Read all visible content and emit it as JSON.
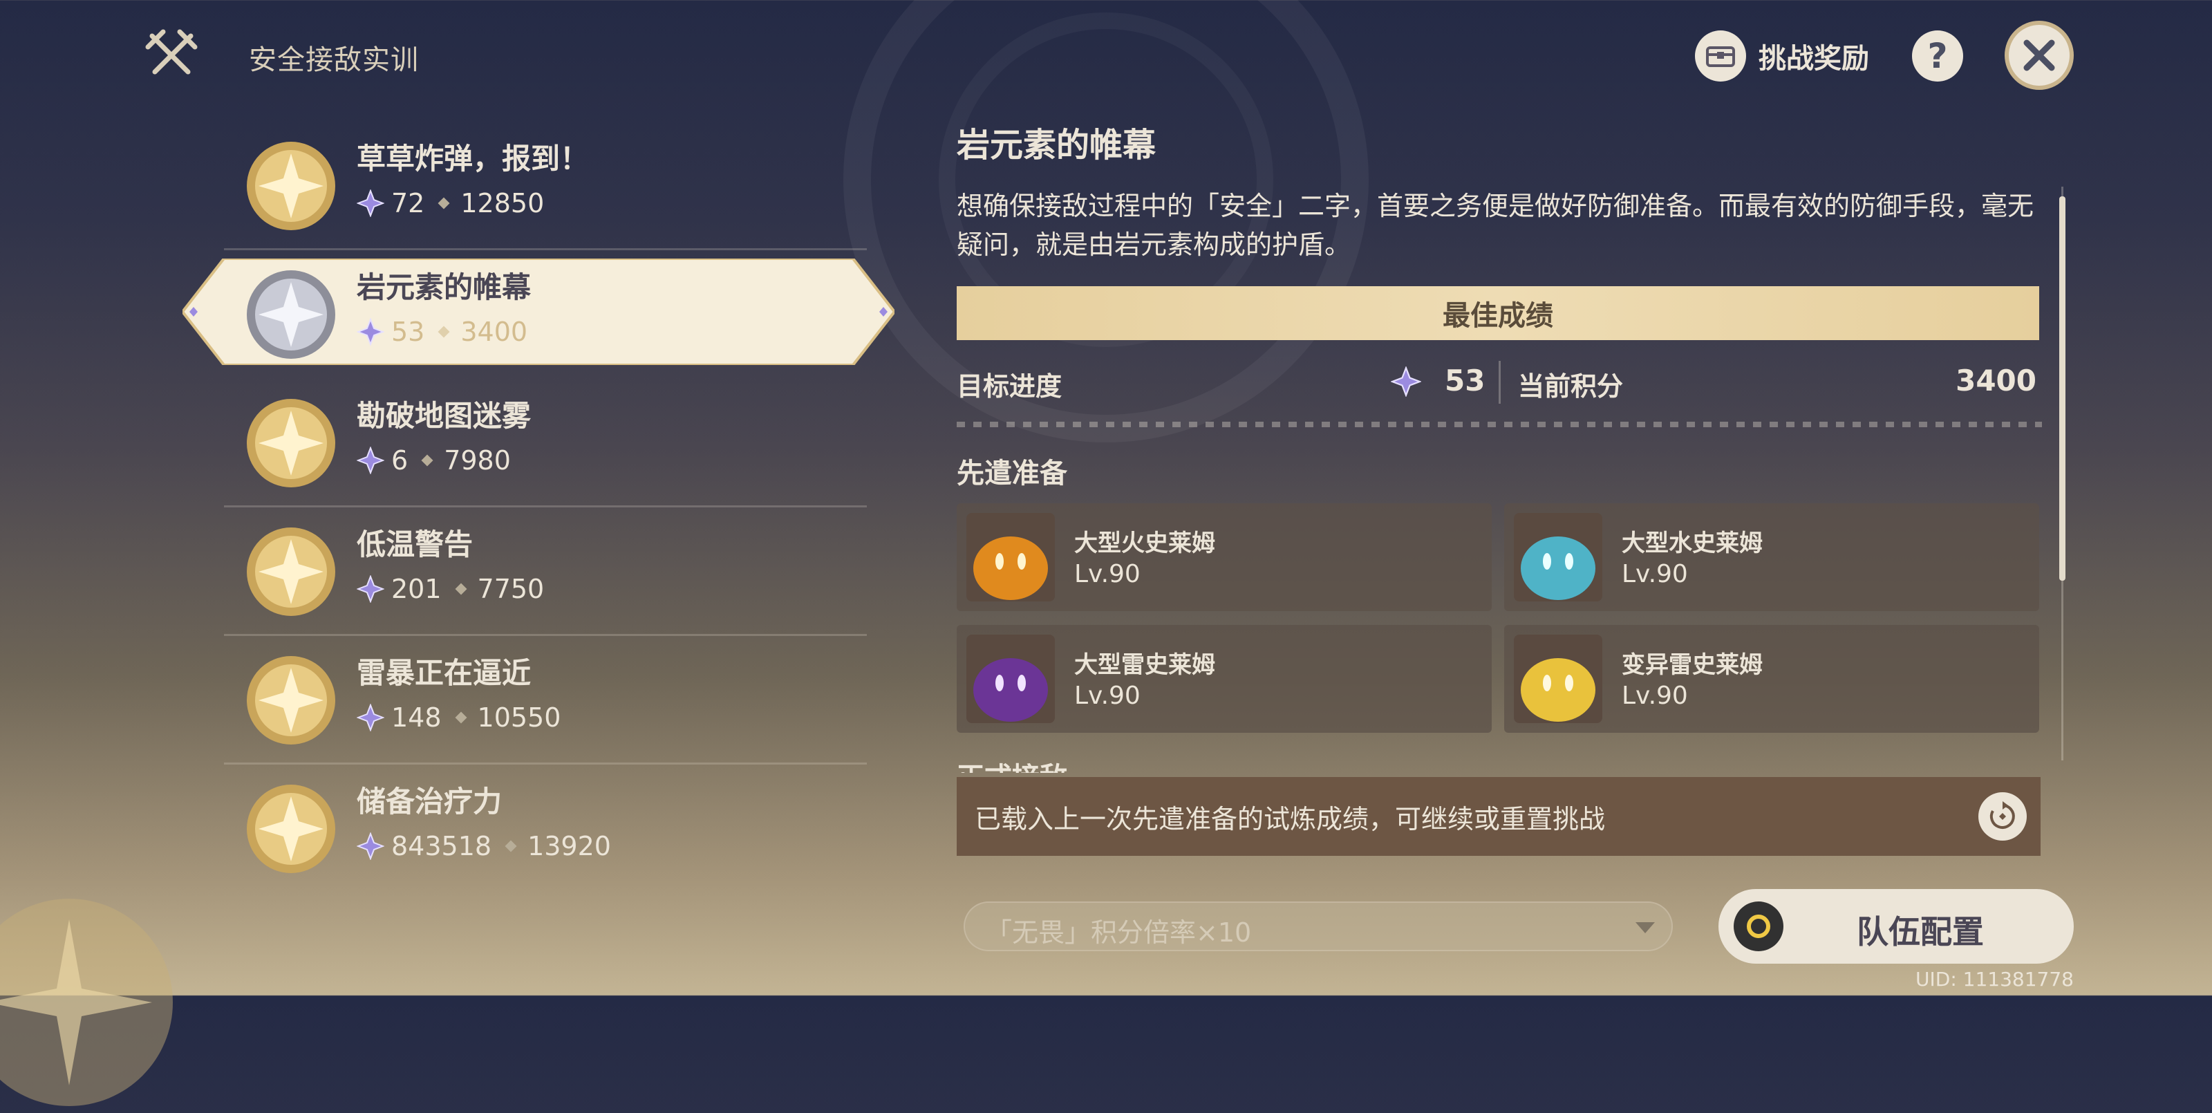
{
  "header": {
    "title": "安全接敌实训",
    "reward_label": "挑战奖励",
    "help_label": "?"
  },
  "challenges": [
    {
      "name": "草草炸弹，报到！",
      "stars": "72",
      "score": "12850",
      "medal": "gold"
    },
    {
      "name": "岩元素的帷幕",
      "stars": "53",
      "score": "3400",
      "medal": "silver",
      "selected": true
    },
    {
      "name": "勘破地图迷雾",
      "stars": "6",
      "score": "7980",
      "medal": "gold"
    },
    {
      "name": "低温警告",
      "stars": "201",
      "score": "7750",
      "medal": "gold"
    },
    {
      "name": "雷暴正在逼近",
      "stars": "148",
      "score": "10550",
      "medal": "gold"
    },
    {
      "name": "储备治疗力",
      "stars": "843518",
      "score": "13920",
      "medal": "gold"
    }
  ],
  "detail": {
    "title": "岩元素的帷幕",
    "description": "想确保接敌过程中的「安全」二字，首要之务便是做好防御准备。而最有效的防御手段，毫无疑问，就是由岩元素构成的护盾。",
    "best_label": "最佳成绩",
    "target_label": "目标进度",
    "target_value": "53",
    "score_label": "当前积分",
    "score_value": "3400",
    "section_prep": "先遣准备",
    "section_formal": "正式接敌",
    "enemies": [
      {
        "name": "大型火史莱姆",
        "level": "Lv.90",
        "color": "#e08a1e"
      },
      {
        "name": "大型水史莱姆",
        "level": "Lv.90",
        "color": "#4fb3c7"
      },
      {
        "name": "大型雷史莱姆",
        "level": "Lv.90",
        "color": "#6b3596"
      },
      {
        "name": "变异雷史莱姆",
        "level": "Lv.90",
        "color": "#e9c23c"
      }
    ],
    "notice": "已载入上一次先遣准备的试炼成绩，可继续或重置挑战"
  },
  "footer": {
    "multiplier": "「无畏」积分倍率×10",
    "team_button": "队伍配置",
    "uid": "UID: 111381778"
  },
  "colors": {
    "text": "#ece5d8",
    "gold": "#d3bc8e",
    "star": "#9b8be0"
  }
}
